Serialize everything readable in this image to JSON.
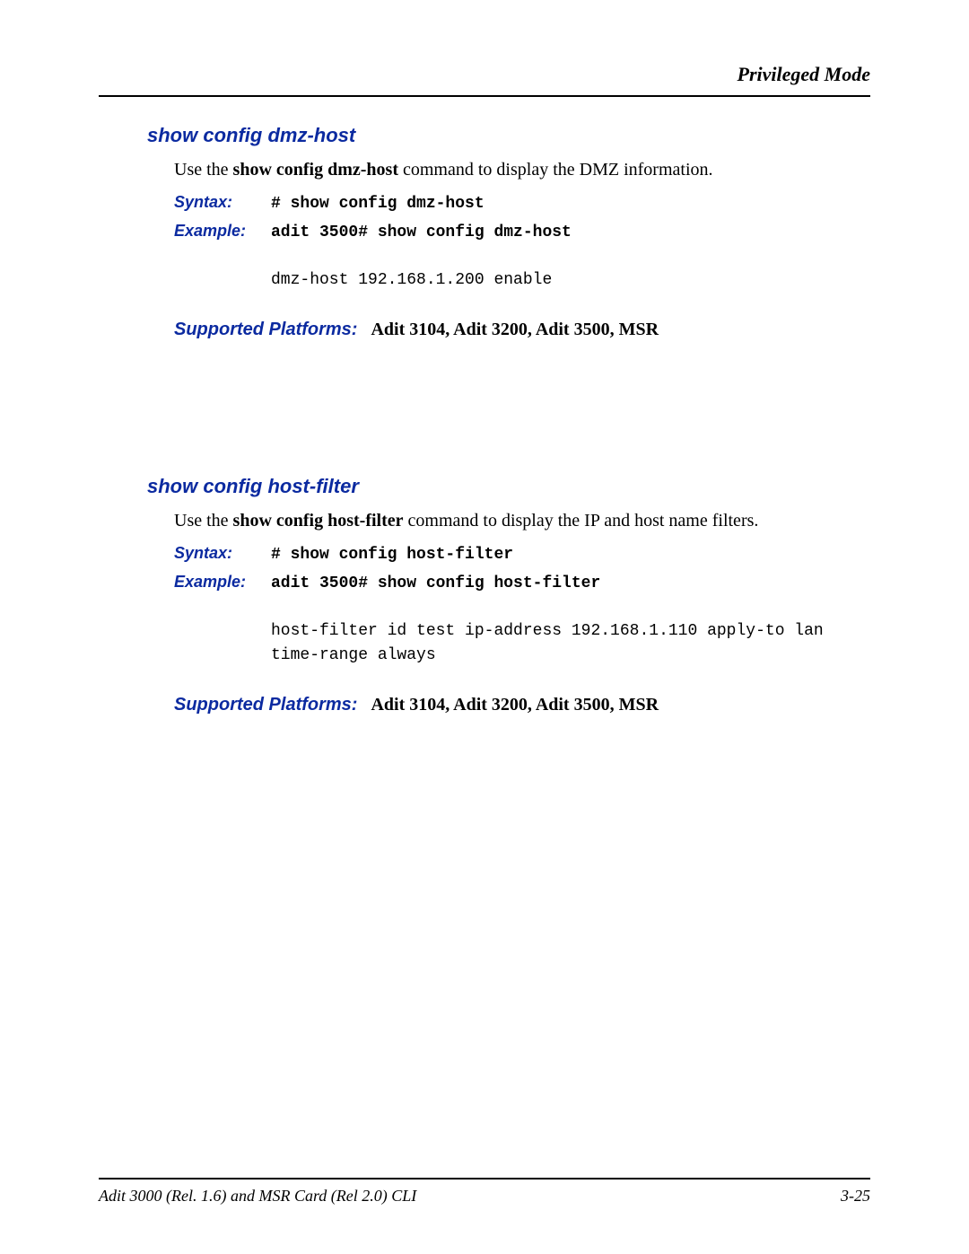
{
  "header": {
    "mode": "Privileged Mode"
  },
  "sections": [
    {
      "title": "show config dmz-host",
      "intro_prefix": "Use the ",
      "intro_cmd": "show config dmz-host",
      "intro_suffix": " command to display the DMZ information.",
      "syntax_label": "Syntax:",
      "syntax": "# show config dmz-host",
      "example_label": "Example:",
      "example": "adit 3500# show config dmz-host",
      "output": "dmz-host 192.168.1.200 enable",
      "platforms_label": "Supported Platforms:",
      "platforms": "Adit 3104, Adit 3200, Adit 3500, MSR"
    },
    {
      "title": "show config host-filter",
      "intro_prefix": "Use the ",
      "intro_cmd": "show config host-filter",
      "intro_suffix": " command to display the IP and host name filters.",
      "syntax_label": "Syntax:",
      "syntax": "# show config host-filter",
      "example_label": "Example:",
      "example": "adit 3500# show config host-filter",
      "output": "host-filter id test ip-address 192.168.1.110 apply-to lan\ntime-range always",
      "platforms_label": "Supported Platforms:",
      "platforms": "Adit 3104, Adit 3200, Adit 3500, MSR"
    }
  ],
  "footer": {
    "left": "Adit 3000 (Rel. 1.6) and MSR Card (Rel 2.0) CLI",
    "right": "3-25"
  }
}
